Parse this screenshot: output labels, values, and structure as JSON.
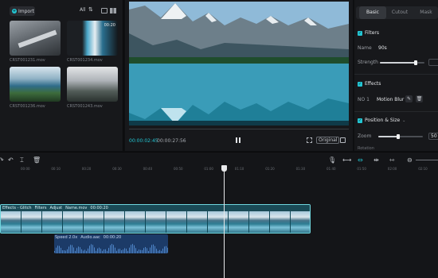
{
  "media": {
    "import_label": "Import",
    "filter_label": "All",
    "items": [
      {
        "label": "CRST001231.mov",
        "duration": ""
      },
      {
        "label": "CRST001234.mov",
        "duration": "00:20"
      },
      {
        "label": "CRST001236.mov",
        "duration": ""
      },
      {
        "label": "CRST001243.mov",
        "duration": ""
      }
    ]
  },
  "player": {
    "time_current": "00:00:02:45",
    "time_total": "00:00:27:56",
    "ratio_label": "Original"
  },
  "inspector": {
    "tabs": [
      "Basic",
      "Cutout",
      "Mask"
    ],
    "filters": {
      "title": "Filters",
      "name_label": "Name",
      "name_value": "90s",
      "strength_label": "Strength",
      "strength_fraction": 0.8
    },
    "effects": {
      "title": "Effects",
      "number_label": "NO 1",
      "effect_name": "Motion Blur"
    },
    "position_size": {
      "title": "Position & Size",
      "zoom_label": "Zoom",
      "zoom_value": "50",
      "zoom_fraction": 0.45,
      "rotation_label": "Rotation"
    }
  },
  "timeline": {
    "ticks": [
      "00:00",
      "00:10",
      "00:20",
      "00:30",
      "00:40",
      "00:50",
      "01:00",
      "01:10",
      "01:20",
      "01:30",
      "01:40",
      "01:50",
      "02:00",
      "02:10"
    ],
    "video_clip": {
      "tags": [
        "Effects - Glitch",
        "Filters",
        "Adjust",
        "Name.mov",
        "00:00:20"
      ],
      "frame_count": 15
    },
    "audio_clip": {
      "tags": [
        "Speed 2.0x",
        "Audio.aac",
        "00:00:20"
      ]
    }
  },
  "colors": {
    "accent": "#23c6d3",
    "video_clip": "#1a6e80",
    "audio_clip": "#1c3b68",
    "background": "#0e0f11"
  }
}
